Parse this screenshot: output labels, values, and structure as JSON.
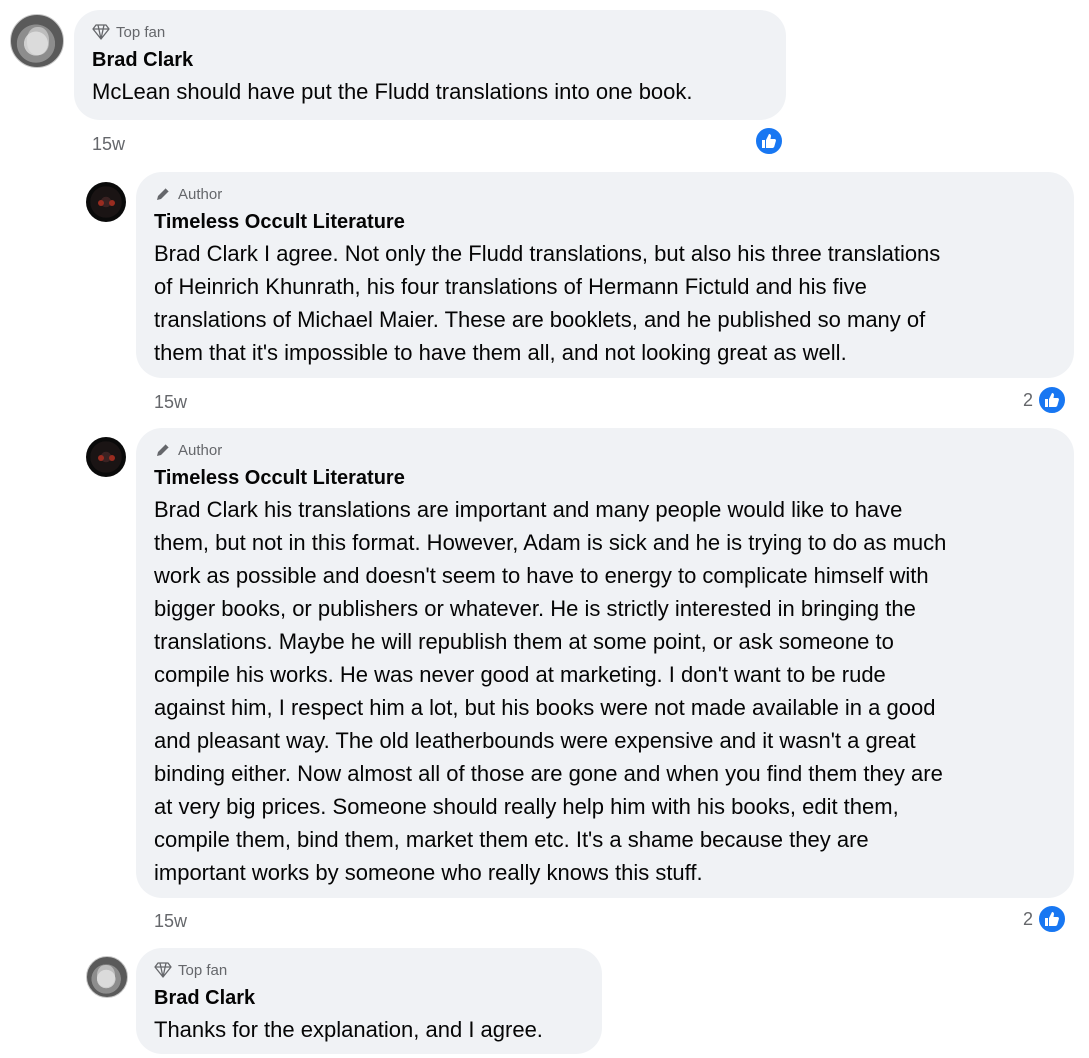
{
  "comments": [
    {
      "badge": "Top fan",
      "badge_icon": "diamond-icon",
      "author": "Brad Clark",
      "text": "McLean should have put the Fludd translations into one book.",
      "time": "15w",
      "reaction_count": ""
    },
    {
      "badge": "Author",
      "badge_icon": "pencil-icon",
      "author": "Timeless Occult Literature",
      "text": "Brad Clark I agree. Not only the Fludd translations, but also his three translations\nof Heinrich Khunrath, his four translations of Hermann Fictuld and his five\ntranslations of Michael Maier. These are booklets, and he published so many of\nthem that it's impossible to have them all, and not looking great as well.",
      "time": "15w",
      "reaction_count": "2"
    },
    {
      "badge": "Author",
      "badge_icon": "pencil-icon",
      "author": "Timeless Occult Literature",
      "text": "Brad Clark his translations are important and many people would like to have\nthem, but not in this format. However, Adam is sick and he is trying to do as much\nwork as possible and doesn't seem to have to energy to complicate himself with\nbigger books, or publishers or whatever. He is strictly interested in bringing the\ntranslations. Maybe he will republish them at some point, or ask someone to\ncompile his works. He was never good at marketing. I don't want to be rude\nagainst him, I respect him a lot, but his books were not made available in a good\nand pleasant way. The old leatherbounds were expensive and it wasn't a great\nbinding either. Now almost all of those are gone and when you find them they are\nat very big prices. Someone should really help him with his books, edit them,\ncompile them, bind them, market them etc. It's a shame because they are\nimportant works by someone who really knows this stuff.",
      "time": "15w",
      "reaction_count": "2"
    },
    {
      "badge": "Top fan",
      "badge_icon": "diamond-icon",
      "author": "Brad Clark",
      "text": "Thanks for the explanation, and I agree.",
      "time": "",
      "reaction_count": ""
    }
  ],
  "colors": {
    "bubble": "#f0f2f5",
    "like": "#1877f2",
    "secondary_text": "#65676b"
  }
}
